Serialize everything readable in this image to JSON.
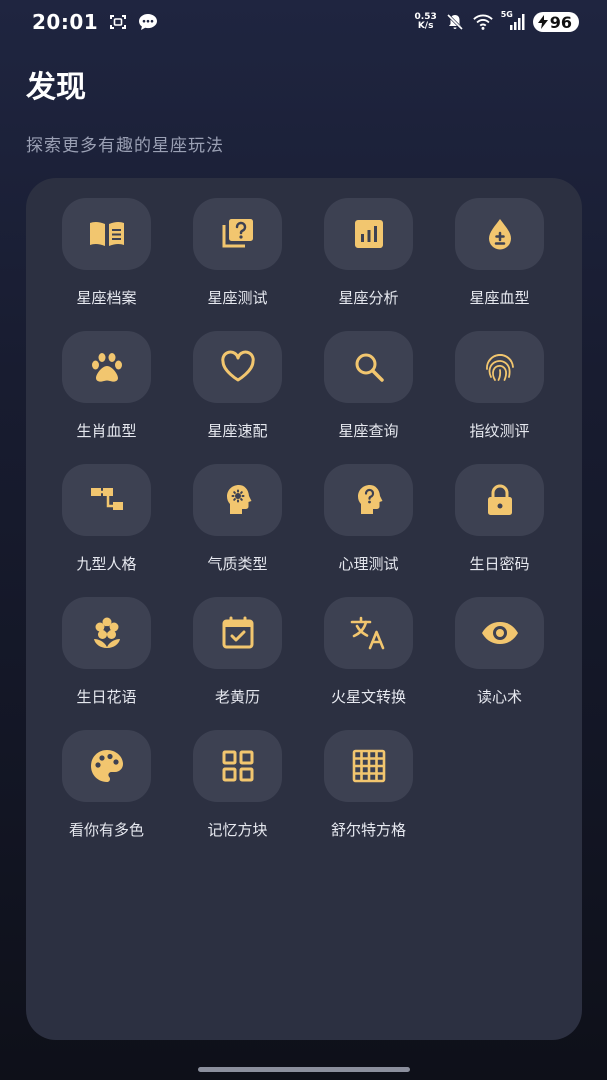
{
  "status_bar": {
    "time": "20:01",
    "net_speed_value": "0.53",
    "net_speed_unit": "K/s",
    "signal_label": "5G",
    "battery_level": "96",
    "icons": [
      "screenshot-icon",
      "message-icon",
      "mute-icon",
      "wifi-icon",
      "signal-icon",
      "battery-charging-icon"
    ]
  },
  "header": {
    "title": "发现",
    "subtitle": "探索更多有趣的星座玩法"
  },
  "theme": {
    "icon_color": "#f2c66f",
    "panel_color": "#2c3041",
    "tile_color": "#3d4152"
  },
  "tools": [
    {
      "label": "星座档案",
      "icon": "book-icon"
    },
    {
      "label": "星座测试",
      "icon": "quiz-icon"
    },
    {
      "label": "星座分析",
      "icon": "bar-chart-icon"
    },
    {
      "label": "星座血型",
      "icon": "blood-drop-icon"
    },
    {
      "label": "生肖血型",
      "icon": "paw-icon"
    },
    {
      "label": "星座速配",
      "icon": "heart-icon"
    },
    {
      "label": "星座查询",
      "icon": "search-icon"
    },
    {
      "label": "指纹测评",
      "icon": "fingerprint-icon"
    },
    {
      "label": "九型人格",
      "icon": "hierarchy-icon"
    },
    {
      "label": "气质类型",
      "icon": "head-gear-icon"
    },
    {
      "label": "心理测试",
      "icon": "head-question-icon"
    },
    {
      "label": "生日密码",
      "icon": "lock-icon"
    },
    {
      "label": "生日花语",
      "icon": "flower-icon"
    },
    {
      "label": "老黄历",
      "icon": "calendar-check-icon"
    },
    {
      "label": "火星文转换",
      "icon": "translate-icon"
    },
    {
      "label": "读心术",
      "icon": "eye-icon"
    },
    {
      "label": "看你有多色",
      "icon": "palette-icon"
    },
    {
      "label": "记忆方块",
      "icon": "grid-squares-icon"
    },
    {
      "label": "舒尔特方格",
      "icon": "table-grid-icon"
    }
  ]
}
